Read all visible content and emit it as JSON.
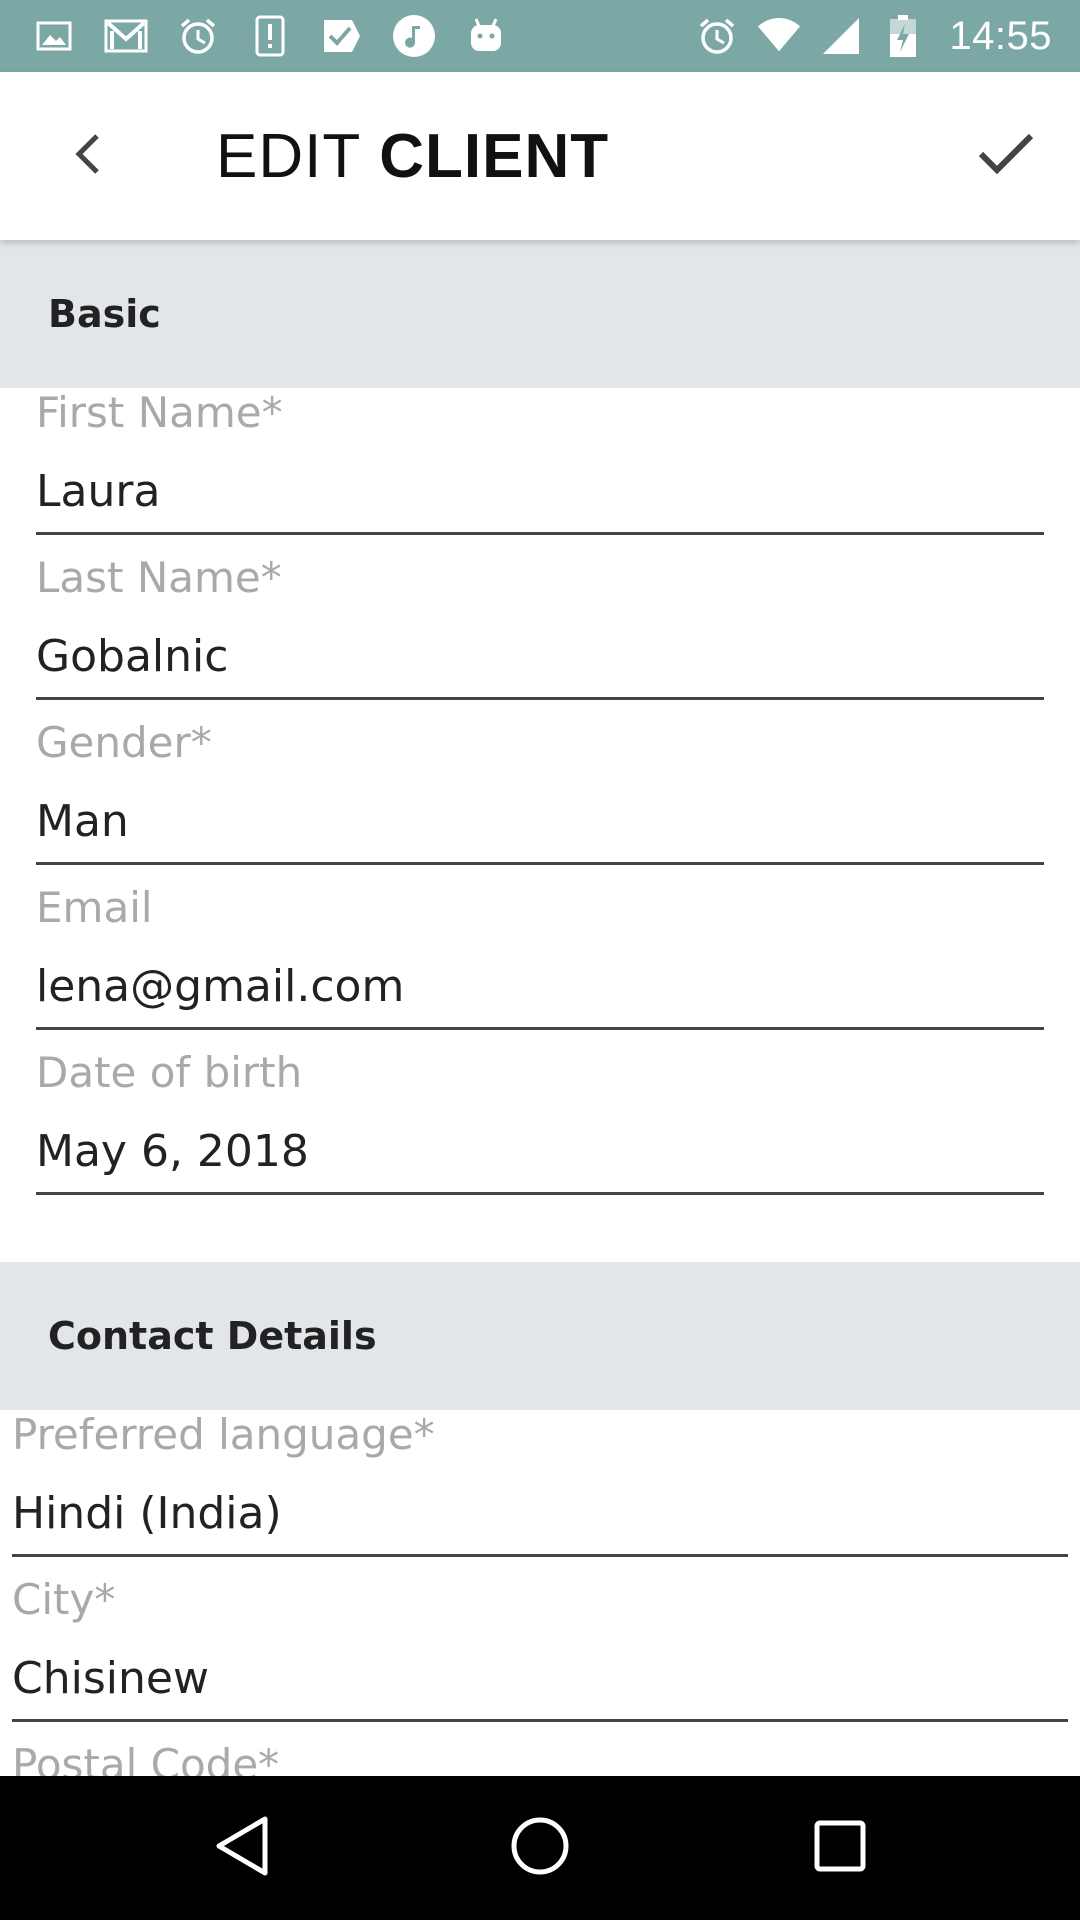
{
  "status_bar": {
    "time": "14:55",
    "left_icons": [
      "image-icon",
      "gmail-icon",
      "alarm-icon",
      "alert-icon",
      "task-icon",
      "music-icon",
      "android-icon"
    ],
    "right_icons": [
      "alarm-icon",
      "wifi-icon",
      "signal-icon",
      "battery-icon"
    ],
    "background": "#7BA8A4"
  },
  "app_bar": {
    "title_light": "EDIT",
    "title_bold": "CLIENT",
    "back_icon": "chevron-left-icon",
    "confirm_icon": "check-icon"
  },
  "sections": {
    "basic": {
      "label": "Basic",
      "fields": {
        "first_name": {
          "label": "First Name*",
          "value": "Laura"
        },
        "last_name": {
          "label": "Last Name*",
          "value": "Gobalnic"
        },
        "gender": {
          "label": "Gender*",
          "value": "Man"
        },
        "email": {
          "label": "Email",
          "value": "lena@gmail.com"
        },
        "dob": {
          "label": "Date of birth",
          "value": "May 6, 2018"
        }
      }
    },
    "contact": {
      "label": "Contact Details",
      "fields": {
        "language": {
          "label": "Preferred language*",
          "value": "Hindi (India)"
        },
        "city": {
          "label": "City*",
          "value": "Chisinew"
        },
        "postal_code": {
          "label": "Postal Code*",
          "value": ""
        }
      }
    }
  },
  "colors": {
    "section_bg": "#E2E6EA",
    "label_gray": "#A9A9A9",
    "underline": "#444444"
  },
  "nav_bar": {
    "icons": [
      "back-triangle-icon",
      "home-circle-icon",
      "recents-square-icon"
    ]
  }
}
